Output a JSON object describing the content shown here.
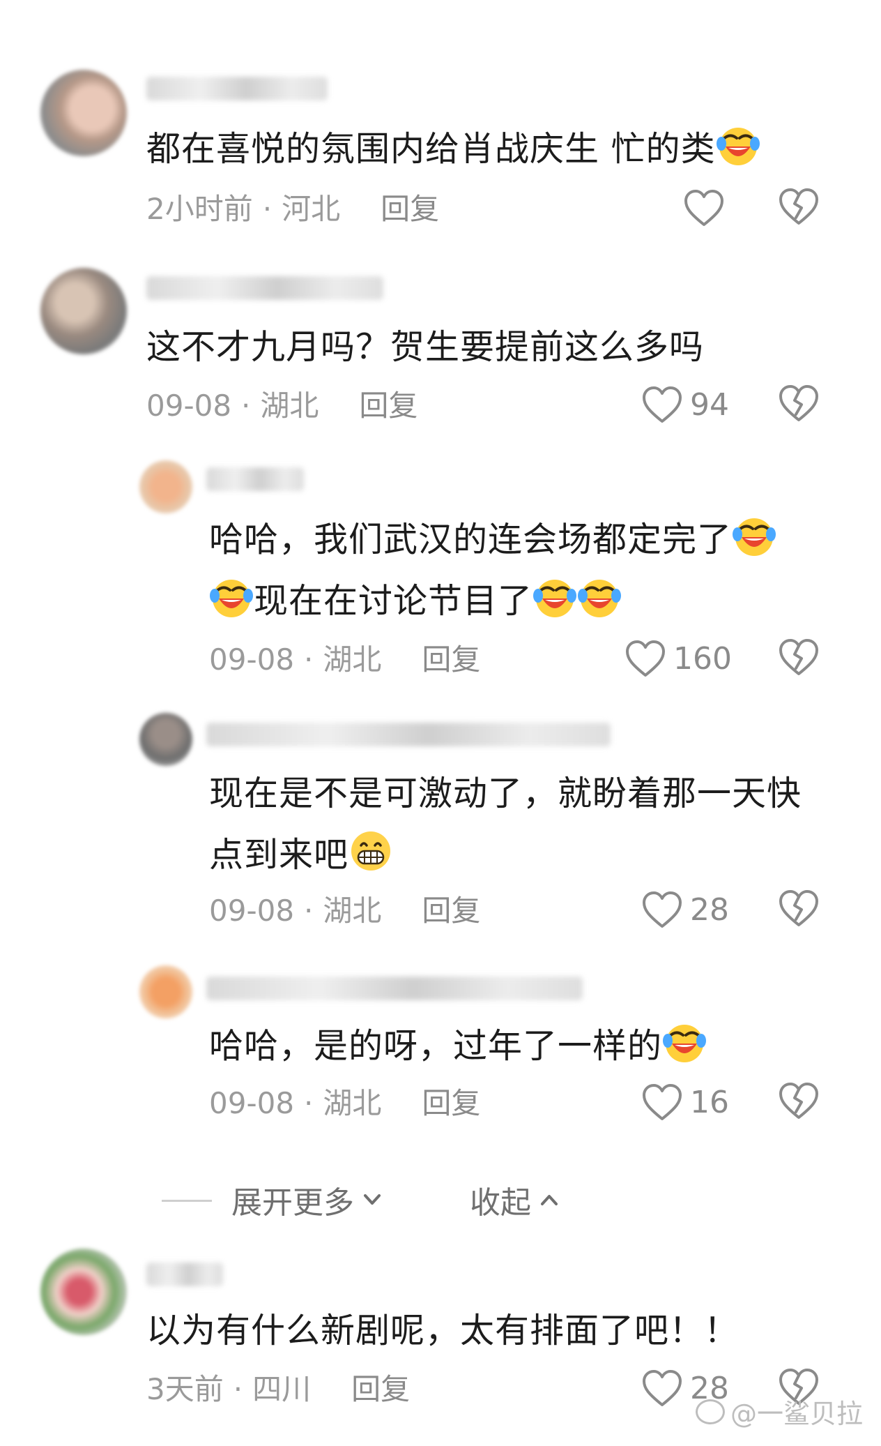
{
  "comments": [
    {
      "text": "都在喜悦的氛围内给肖战庆生 忙的类",
      "time": "2小时前",
      "location": "河北",
      "reply": "回复",
      "likes": ""
    },
    {
      "text": "这不才九月吗？贺生要提前这么多吗",
      "time": "09-08",
      "location": "湖北",
      "reply": "回复",
      "likes": "94"
    },
    {
      "text_line1": "哈哈，我们武汉的连会场都定完了",
      "text_line2": "现在在讨论节目了",
      "time": "09-08",
      "location": "湖北",
      "reply": "回复",
      "likes": "160"
    },
    {
      "text_line1": "现在是不是可激动了，就盼着那一天快",
      "text_line2": "点到来吧",
      "time": "09-08",
      "location": "湖北",
      "reply": "回复",
      "likes": "28"
    },
    {
      "text": "哈哈，是的呀，过年了一样的",
      "time": "09-08",
      "location": "湖北",
      "reply": "回复",
      "likes": "16"
    },
    {
      "text": "以为有什么新剧呢，太有排面了吧！！",
      "time": "3天前",
      "location": "四川",
      "reply": "回复",
      "likes": "28"
    }
  ],
  "expand": {
    "label": "展开更多"
  },
  "collapse": {
    "label": "收起"
  },
  "watermark": {
    "text": "@一鲨贝拉"
  },
  "separator": "·"
}
